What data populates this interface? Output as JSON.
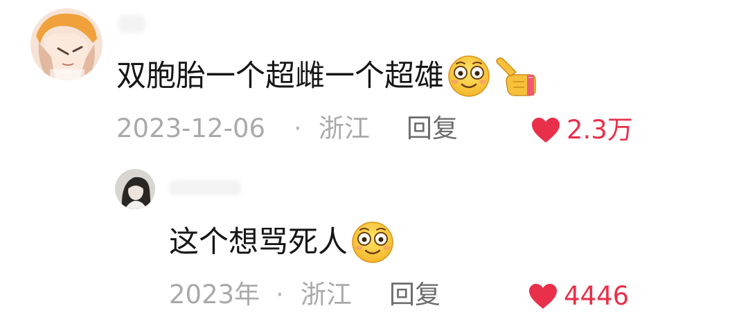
{
  "comments": [
    {
      "text": "双胞胎一个超雌一个超雄",
      "emojis": [
        "flushed-smile-icon",
        "backhand-index-pointing-left-icon"
      ],
      "date": "2023-12-06",
      "separator": "·",
      "location": "浙江",
      "reply_label": "回复",
      "like_icon": "heart-icon",
      "like_color": "#e8304a",
      "like_count": "2.3万"
    },
    {
      "text": "这个想骂死人",
      "emojis": [
        "flushed-smile-icon"
      ],
      "date": "2023年",
      "separator": "·",
      "location": "浙江",
      "reply_label": "回复",
      "like_icon": "heart-icon",
      "like_color": "#e8304a",
      "like_count": "4446"
    }
  ]
}
